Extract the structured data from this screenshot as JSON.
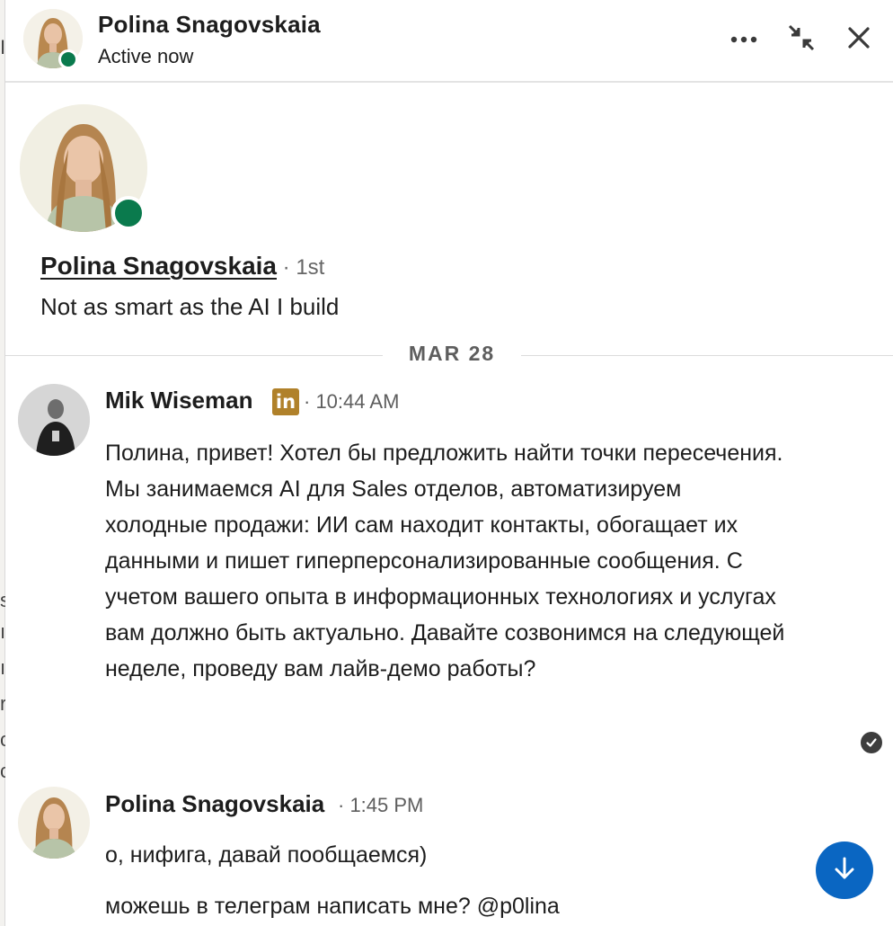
{
  "header": {
    "name": "Polina Snagovskaia",
    "status": "Active now",
    "more_icon": "more-dots-icon",
    "collapse_icon": "minimize-arrows-icon",
    "close_icon": "close-icon"
  },
  "profile": {
    "name": "Polina Snagovskaia",
    "degree": " · 1st",
    "headline": "Not as smart as the AI I build"
  },
  "date_divider": "MAR 28",
  "messages": [
    {
      "sender": "Mik Wiseman",
      "badge": "in",
      "time": " · 10:44 AM",
      "paragraphs": [
        "Полина, привет! Хотел бы предложить найти точки пересечения. Мы занимаемся AI для Sales отделов, автоматизируем холодные продажи: ИИ сам находит контакты, обогащает их данными и пишет гиперперсонализированные сообщения. С учетом вашего опыта в информационных технологиях и услугах вам должно быть актуально. Давайте созвонимся на следующей неделе, проведу вам лайв-демо работы?"
      ]
    },
    {
      "sender": "Polina Snagovskaia",
      "time": " · 1:45 PM",
      "paragraphs": [
        "о, нифига, давай пообщаемся)",
        "можешь в телеграм написать мне? @p0lina"
      ]
    }
  ],
  "colors": {
    "online": "#0a7a4d",
    "primary": "#0a66c2",
    "premium_badge": "#b0812a"
  }
}
